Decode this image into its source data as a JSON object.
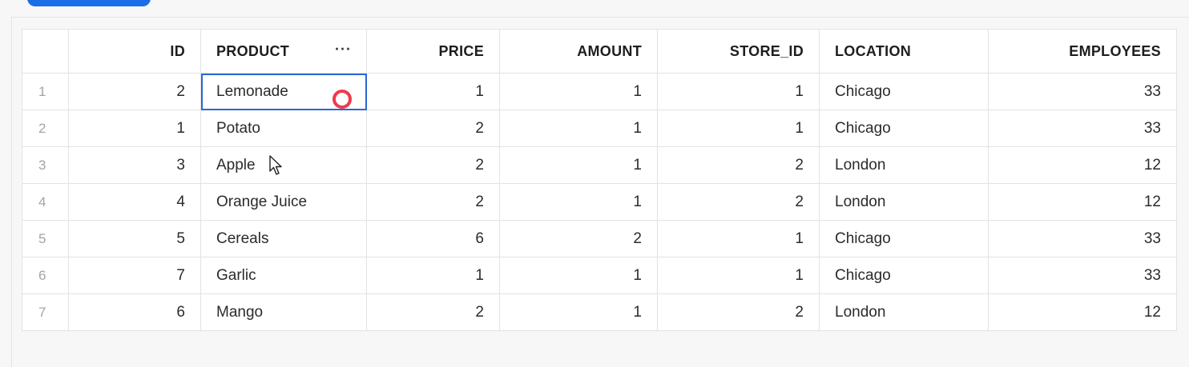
{
  "table": {
    "columns": [
      {
        "key": "rownum",
        "label": ""
      },
      {
        "key": "id",
        "label": "ID"
      },
      {
        "key": "product",
        "label": "PRODUCT"
      },
      {
        "key": "price",
        "label": "PRICE"
      },
      {
        "key": "amount",
        "label": "AMOUNT"
      },
      {
        "key": "store_id",
        "label": "STORE_ID"
      },
      {
        "key": "location",
        "label": "LOCATION"
      },
      {
        "key": "employees",
        "label": "EMPLOYEES"
      }
    ],
    "column_menu_icon": "more-horizontal-icon",
    "column_menu_glyph": "···",
    "rows": [
      {
        "rownum": "1",
        "id": "2",
        "product": "Lemonade",
        "price": "1",
        "amount": "1",
        "store_id": "1",
        "location": "Chicago",
        "employees": "33"
      },
      {
        "rownum": "2",
        "id": "1",
        "product": "Potato",
        "price": "2",
        "amount": "1",
        "store_id": "1",
        "location": "Chicago",
        "employees": "33"
      },
      {
        "rownum": "3",
        "id": "3",
        "product": "Apple",
        "price": "2",
        "amount": "1",
        "store_id": "2",
        "location": "London",
        "employees": "12"
      },
      {
        "rownum": "4",
        "id": "4",
        "product": "Orange Juice",
        "price": "2",
        "amount": "1",
        "store_id": "2",
        "location": "London",
        "employees": "12"
      },
      {
        "rownum": "5",
        "id": "5",
        "product": "Cereals",
        "price": "6",
        "amount": "2",
        "store_id": "1",
        "location": "Chicago",
        "employees": "33"
      },
      {
        "rownum": "6",
        "id": "7",
        "product": "Garlic",
        "price": "1",
        "amount": "1",
        "store_id": "1",
        "location": "Chicago",
        "employees": "33"
      },
      {
        "rownum": "7",
        "id": "6",
        "product": "Mango",
        "price": "2",
        "amount": "1",
        "store_id": "2",
        "location": "London",
        "employees": "12"
      }
    ],
    "selected_cell": {
      "row": 0,
      "column": "product"
    }
  },
  "colors": {
    "accent": "#1a6ee8",
    "selection": "#2a67d6",
    "click_marker": "#ee3b4b"
  }
}
